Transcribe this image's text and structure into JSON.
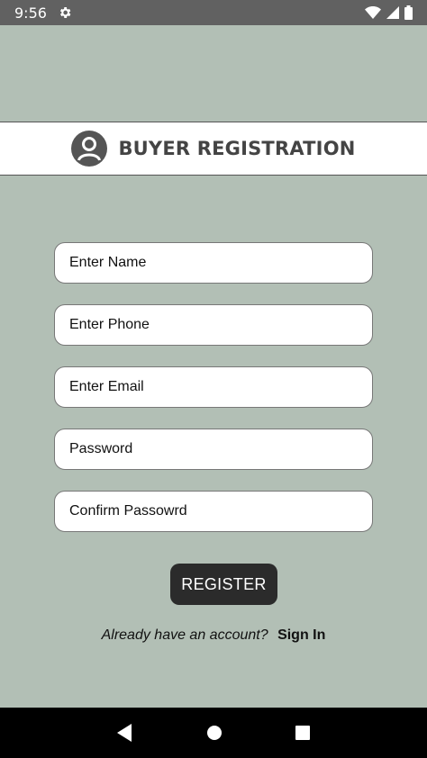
{
  "status_bar": {
    "time": "9:56"
  },
  "header": {
    "title": "BUYER REGISTRATION"
  },
  "form": {
    "name_placeholder": "Enter Name",
    "phone_placeholder": "Enter Phone",
    "email_placeholder": "Enter Email",
    "password_placeholder": "Password",
    "confirm_placeholder": "Confirm Passowrd"
  },
  "register_label": "REGISTER",
  "footer": {
    "prompt": "Already have an account?",
    "signin_label": "Sign In"
  },
  "colors": {
    "background": "#b2bfb5",
    "header_bg": "#ffffff",
    "button_bg": "#2b2b2b",
    "status_bar": "#616161",
    "nav_bar": "#000000"
  },
  "icons": [
    "settings-gear-icon",
    "wifi-icon",
    "cell-signal-icon",
    "battery-icon",
    "user-avatar-icon",
    "nav-back-icon",
    "nav-home-icon",
    "nav-recents-icon"
  ]
}
